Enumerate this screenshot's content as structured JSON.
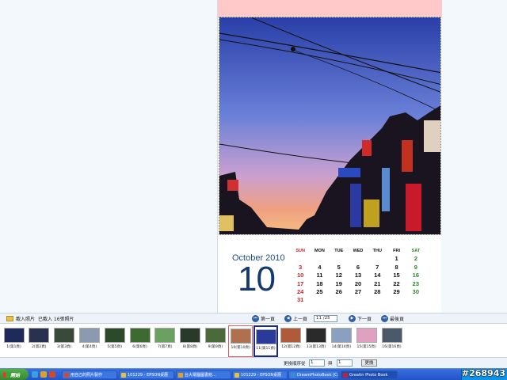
{
  "toolbar": {
    "load_label": "載入照片",
    "loaded_label": "已載入 16張照片",
    "first_label": "第一頁",
    "prev_label": "上一頁",
    "page_value": "11 /25",
    "next_label": "下一頁",
    "last_label": "最後頁"
  },
  "calendar": {
    "month_title": "October 2010",
    "month_num": "10",
    "headers": [
      "SUN",
      "MON",
      "TUE",
      "WED",
      "THU",
      "FRI",
      "SAT"
    ],
    "weeks": [
      [
        "",
        "",
        "",
        "",
        "",
        "1",
        "2"
      ],
      [
        "3",
        "4",
        "5",
        "6",
        "7",
        "8",
        "9"
      ],
      [
        "10",
        "11",
        "12",
        "13",
        "14",
        "15",
        "16"
      ],
      [
        "17",
        "18",
        "19",
        "20",
        "21",
        "22",
        "23"
      ],
      [
        "24",
        "25",
        "26",
        "27",
        "28",
        "29",
        "30"
      ],
      [
        "31",
        "",
        "",
        "",
        "",
        "",
        ""
      ]
    ],
    "colors": {
      "sunday": "#c8242c",
      "saturday": "#2a8a2a",
      "title": "#14386f"
    }
  },
  "thumbnails": [
    {
      "cap": "1(第1頁)",
      "color": "#1d2a5a"
    },
    {
      "cap": "2(第2頁)",
      "color": "#2a3150"
    },
    {
      "cap": "3(第3頁)",
      "color": "#3a4a3a"
    },
    {
      "cap": "4(第4頁)",
      "color": "#8a9ab0"
    },
    {
      "cap": "5(第5頁)",
      "color": "#2a4a2a"
    },
    {
      "cap": "6(第6頁)",
      "color": "#3d6a30"
    },
    {
      "cap": "7(第7頁)",
      "color": "#6aa060"
    },
    {
      "cap": "8(第8頁)",
      "color": "#2a3a2a"
    },
    {
      "cap": "9(第9頁)",
      "color": "#4a6a3a"
    },
    {
      "cap": "10(第10頁)",
      "color": "#b07050"
    },
    {
      "cap": "11(第11頁)",
      "color": "#2a3a9a"
    },
    {
      "cap": "12(第12頁)",
      "color": "#b05a3a"
    },
    {
      "cap": "13(第13頁)",
      "color": "#2a2a2a"
    },
    {
      "cap": "14(第14頁)",
      "color": "#8aa0c0"
    },
    {
      "cap": "15(第15頁)",
      "color": "#e0a0c0"
    },
    {
      "cap": "16(第16頁)",
      "color": "#4a5a6a"
    }
  ],
  "orderbar": {
    "swap_label": "更換順序從",
    "from_value": "1",
    "to_label": "與",
    "to_value": "1",
    "swap_button": "更換"
  },
  "taskbar": {
    "start_label": "開始",
    "tasks": [
      "用自己的照片製作",
      "101229 - EPSON桌曆",
      "台大電腦圖書館…",
      "101229 - EPSON桌曆",
      "DreamPhotoBook (C:)",
      "Greatin Photo Book"
    ]
  },
  "watermark": "#268943"
}
